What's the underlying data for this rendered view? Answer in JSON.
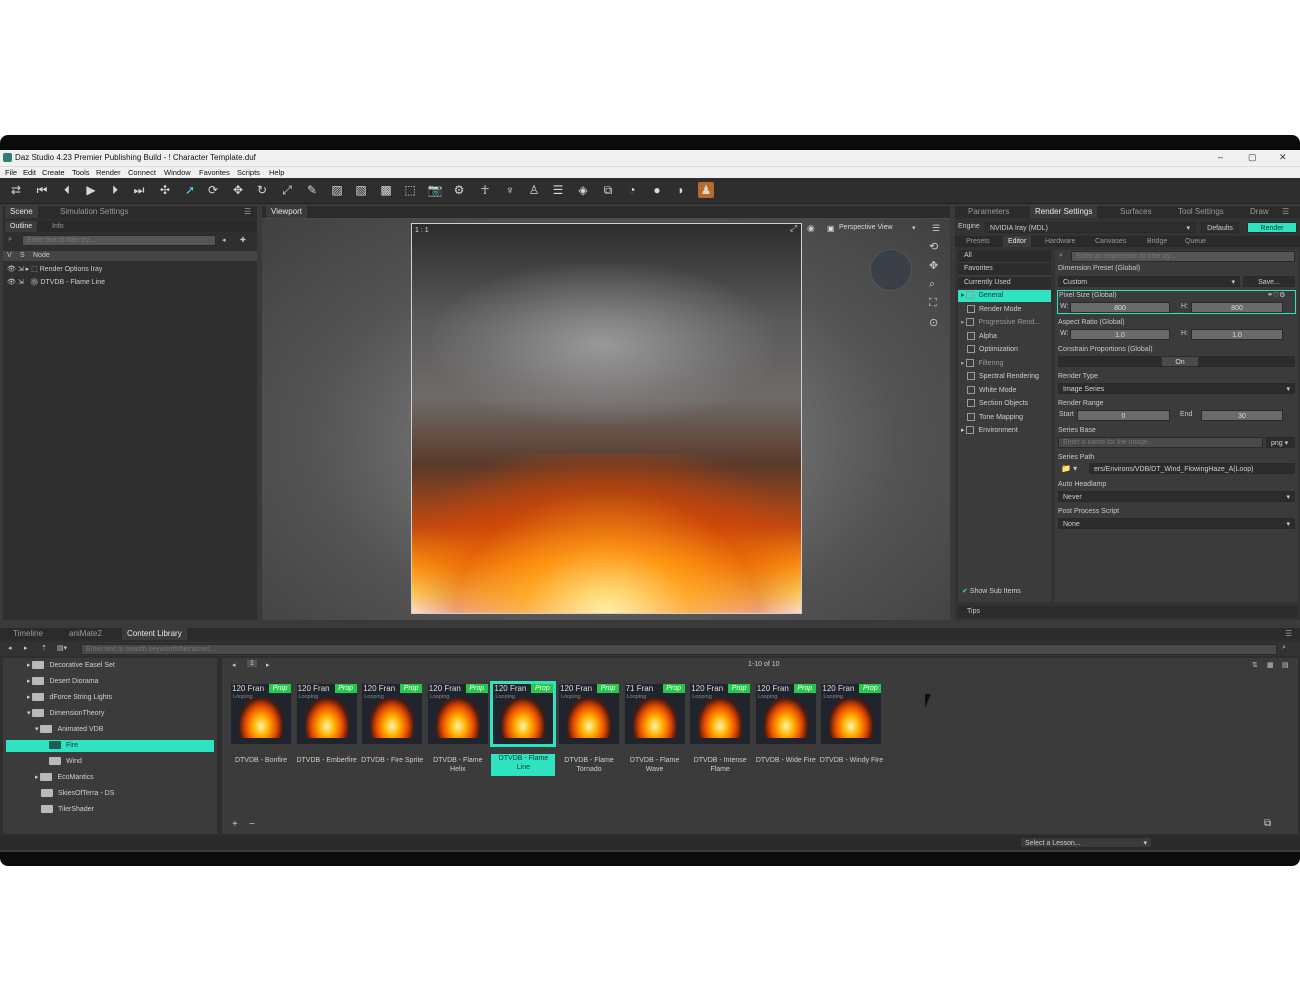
{
  "window": {
    "title": "Daz Studio 4.23 Premier Publishing Build - ! Character Template.duf",
    "min": "–",
    "max": "▢",
    "close": "✕"
  },
  "menu": [
    "File",
    "Edit",
    "Create",
    "Tools",
    "Render",
    "Connect",
    "Window",
    "Favorites",
    "Scripts",
    "Help"
  ],
  "left": {
    "tabs": [
      "Scene",
      "Simulation Settings"
    ],
    "subtabs": [
      "Outline",
      "Info"
    ],
    "filter_placeholder": "Enter text to filter by...",
    "columns": [
      "V",
      "S",
      "Node"
    ],
    "nodes": [
      "Render Options Iray",
      "DTVDB - Flame Line"
    ]
  },
  "viewport": {
    "tab": "Viewport",
    "ratio": "1 : 1",
    "camera": "Perspective View"
  },
  "right": {
    "tabs": [
      "Parameters",
      "Render Settings",
      "Surfaces",
      "Tool Settings",
      "Draw"
    ],
    "engine_label": "Engine",
    "engine_value": "NVIDIA Iray (MDL)",
    "defaults": "Defaults",
    "render": "Render",
    "subtabs": [
      "Presets",
      "Editor",
      "Hardware",
      "Canvases",
      "Bridge",
      "Queue"
    ],
    "filter_placeholder": "Enter an expression to filter by...",
    "groups": [
      "All",
      "Favorites",
      "Currently Used",
      "General",
      "Render Mode",
      "Progressive Rend...",
      "Alpha",
      "Optimization",
      "Filtering",
      "Spectral Rendering",
      "White Mode",
      "Section Objects",
      "Tone Mapping",
      "Environment"
    ],
    "show_sub_items": "Show Sub Items",
    "tips": "Tips",
    "props": {
      "dimension_preset": "Dimension Preset (Global)",
      "dimension_value": "Custom",
      "save": "Save...",
      "pixel_size": "Pixel Size (Global)",
      "w": "W:",
      "h": "H:",
      "pixel_w": "800",
      "pixel_h": "800",
      "aspect": "Aspect Ratio (Global)",
      "aspect_w": "1.0",
      "aspect_h": "1.0",
      "constrain": "Constrain Proportions (Global)",
      "constrain_value": "On",
      "render_type": "Render Type",
      "render_type_value": "Image Series",
      "render_range": "Render Range",
      "start": "Start",
      "start_value": "0",
      "end": "End",
      "end_value": "30",
      "series_base": "Series Base",
      "series_base_placeholder": "Enter a name for the image...",
      "series_ext": "png",
      "series_path": "Series Path",
      "series_path_value": "ers/Environs/VDB/DT_Wind_FlowingHaze_A(Loop)",
      "auto_headlamp": "Auto Headlamp",
      "auto_headlamp_value": "Never",
      "post_process": "Post Process Script",
      "post_process_value": "None"
    }
  },
  "bottom": {
    "tabs": [
      "Timeline",
      "aniMate2",
      "Content Library"
    ],
    "search_placeholder": "Enter text to search keywords/filenames...",
    "tree": [
      "Decorative Easel Set",
      "Desert Diorama",
      "dForce String Lights",
      "DimensionTheory",
      "Animated VDB",
      "Fire",
      "Wind",
      "EcoMantics",
      "SkiesOfTerra - DS",
      "TilerShader"
    ],
    "page_count": "1-10 of 10",
    "items": [
      {
        "cap": "120 Fran",
        "sub": "Looping",
        "badge": "Prop",
        "label": "DTVDB - Bonfire"
      },
      {
        "cap": "120 Fran",
        "sub": "Looping",
        "badge": "Prop",
        "label": "DTVDB - Emberfire"
      },
      {
        "cap": "120 Fran",
        "sub": "Looping",
        "badge": "Prop",
        "label": "DTVDB - Fire Sprite"
      },
      {
        "cap": "120 Fran",
        "sub": "Looping",
        "badge": "Prop",
        "label": "DTVDB - Flame Helix"
      },
      {
        "cap": "120 Fran",
        "sub": "Looping",
        "badge": "Prop",
        "label": "DTVDB - Flame Line"
      },
      {
        "cap": "120 Fran",
        "sub": "Looping",
        "badge": "Prop",
        "label": "DTVDB - Flame Tornado"
      },
      {
        "cap": "71 Fran",
        "sub": "Looping",
        "badge": "Prop",
        "label": "DTVDB - Flame Wave"
      },
      {
        "cap": "120 Fran",
        "sub": "Looping",
        "badge": "Prop",
        "label": "DTVDB - Intense Flame"
      },
      {
        "cap": "120 Fran",
        "sub": "Looping",
        "badge": "Prop",
        "label": "DTVDB - Wide Fire"
      },
      {
        "cap": "120 Fran",
        "sub": "Looping",
        "badge": "Prop",
        "label": "DTVDB - Windy Fire"
      }
    ],
    "lesson": "Select a Lesson..."
  },
  "colors": {
    "accent": "#2fe3c0",
    "badge": "#25c84a",
    "panel": "#3b3b3b"
  }
}
